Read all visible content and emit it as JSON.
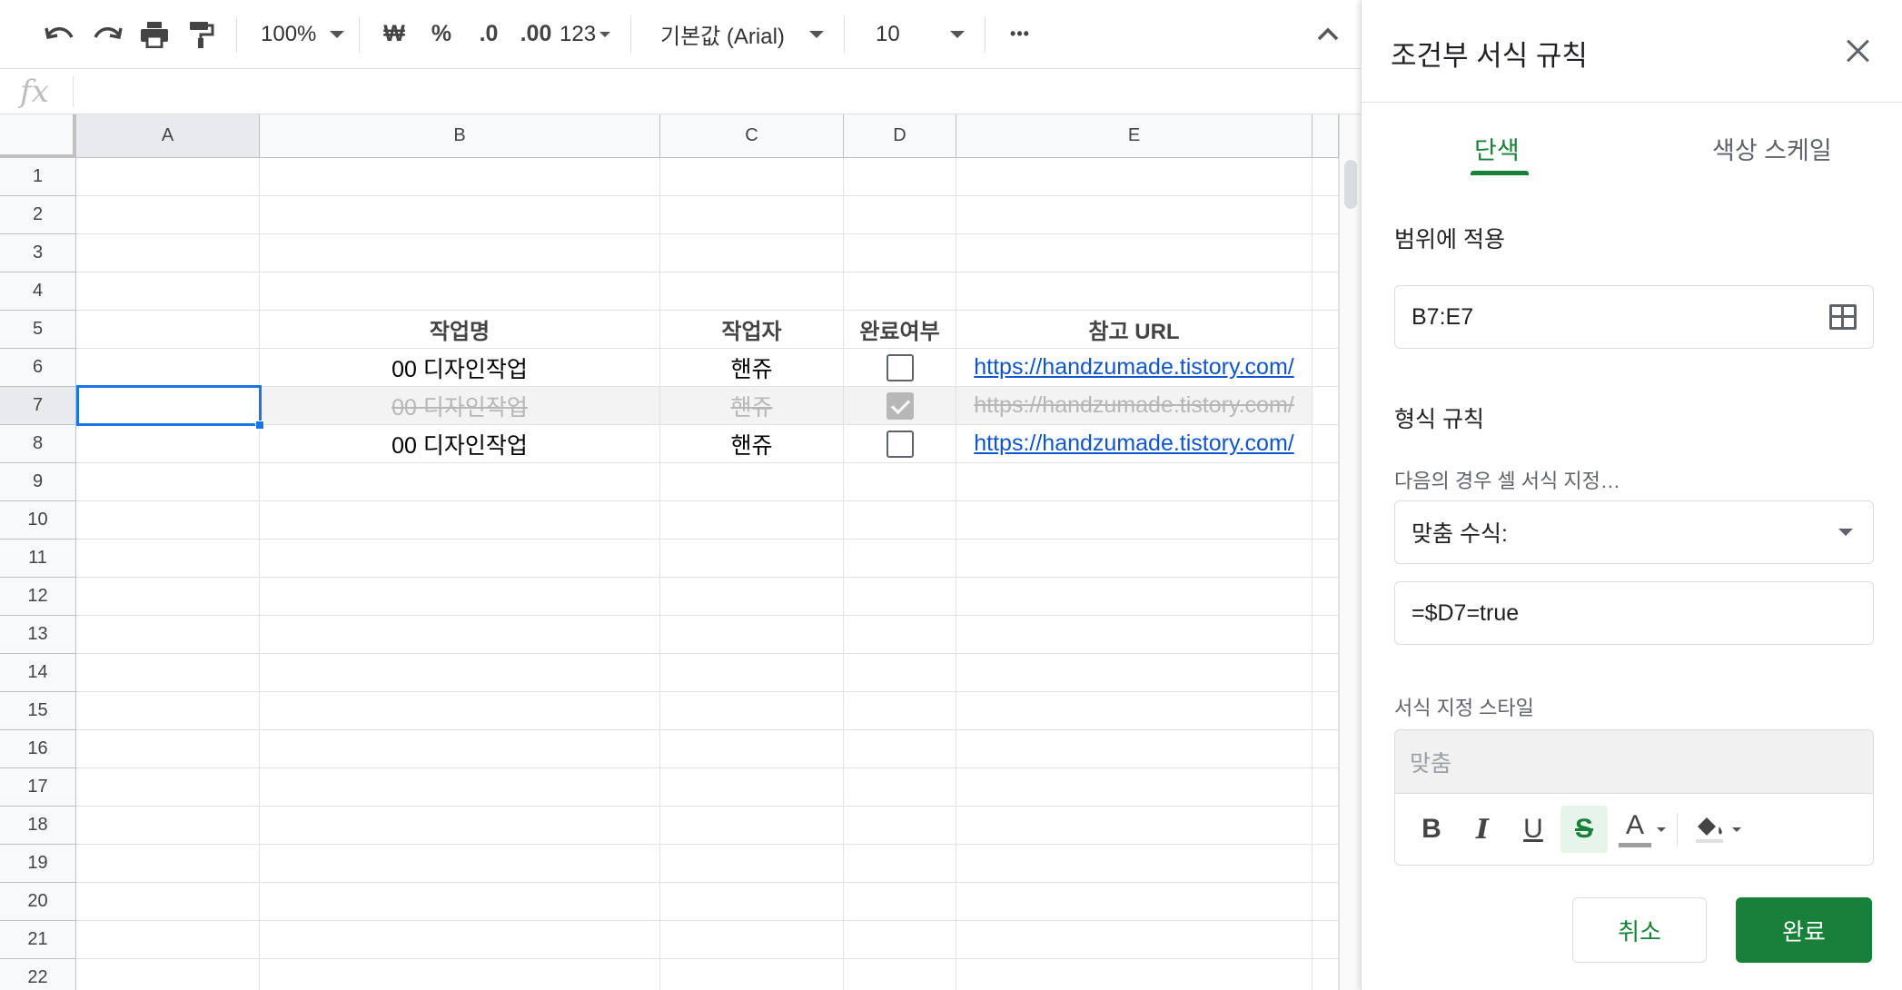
{
  "toolbar": {
    "undo_icon": "undo-icon",
    "redo_icon": "redo-icon",
    "print_icon": "print-icon",
    "paint_format_icon": "paint-format-icon",
    "zoom": "100%",
    "currency": "₩",
    "percent": "%",
    "dec_decrease": ".0",
    "dec_increase": ".00",
    "more_formats": "123",
    "font": "기본값 (Arial)",
    "font_size": "10",
    "more": "•••",
    "collapse_icon": "chevron-up-icon"
  },
  "formula_bar": {
    "fx": "fx",
    "value": ""
  },
  "sheet": {
    "columns": [
      "A",
      "B",
      "C",
      "D",
      "E"
    ],
    "rows": [
      "1",
      "2",
      "3",
      "4",
      "5",
      "6",
      "7",
      "8",
      "9",
      "10",
      "11",
      "12",
      "13",
      "14",
      "15",
      "16",
      "17",
      "18",
      "19",
      "20",
      "21",
      "22"
    ],
    "header_row": {
      "b": "작업명",
      "c": "작업자",
      "d": "완료여부",
      "e": "참고 URL"
    },
    "data": [
      {
        "b": "00 디자인작업",
        "c": "핸쥬",
        "d": false,
        "e": "https://handzumade.tistory.com/",
        "done": false
      },
      {
        "b": "00 디자인작업",
        "c": "핸쥬",
        "d": true,
        "e": "https://handzumade.tistory.com/",
        "done": true
      },
      {
        "b": "00 디자인작업",
        "c": "핸쥬",
        "d": false,
        "e": "https://handzumade.tistory.com/",
        "done": false
      }
    ],
    "selected_cell": "A7"
  },
  "panel": {
    "title": "조건부 서식 규칙",
    "tabs": [
      "단색",
      "색상 스케일"
    ],
    "active_tab": "단색",
    "range_label": "범위에 적용",
    "range_value": "B7:E7",
    "rules_label": "형식 규칙",
    "condition_label": "다음의 경우 셀 서식 지정…",
    "condition_value": "맞춤 수식:",
    "formula_value": "=$D7=true",
    "style_label": "서식 지정 스타일",
    "style_preview": "맞춤",
    "style_buttons": {
      "bold": "B",
      "italic": "I",
      "underline": "U",
      "strike": "S",
      "text_color": "A"
    },
    "cancel_label": "취소",
    "done_label": "완료",
    "accent_color": "#188038",
    "link_color": "#1155cc",
    "selection_color": "#1a73e8"
  }
}
